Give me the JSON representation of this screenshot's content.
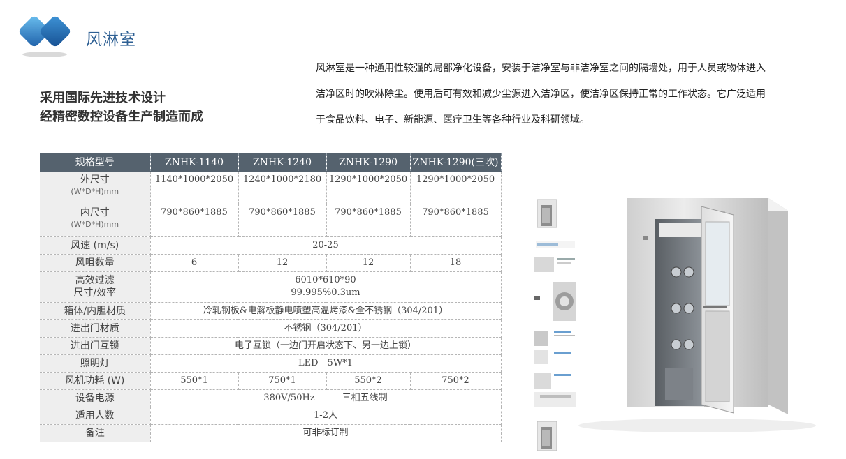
{
  "header": {
    "title": "风淋室",
    "slogan_lines": [
      "采用国际先进技术设计",
      "经精密数控设备生产制造而成"
    ]
  },
  "description": {
    "lines": [
      "风淋室是一种通用性较强的局部净化设备，安装于洁净室与非洁净室之间的隔墙处，用于人员或物体进入",
      "洁净区时的吹淋除尘。使用后可有效和减少尘源进入洁净区，使洁净区保持正常的工作状态。它广泛适用",
      "于食品饮料、电子、新能源、医疗卫生等各种行业及科研领域。"
    ]
  },
  "spec_table": {
    "header": [
      "规格型号",
      "ZNHK-1140",
      "ZNHK-1240",
      "ZNHK-1290",
      "ZNHK-1290(三吹)"
    ],
    "rows": [
      {
        "label": "外尺寸",
        "sub": "(W*D*H)mm",
        "cells": [
          "1140*1000*2050",
          "1240*1000*2180",
          "1290*1000*2050",
          "1290*1000*2050"
        ]
      },
      {
        "label": "内尺寸",
        "sub": "(W*D*H)mm",
        "cells": [
          "790*860*1885",
          "790*860*1885",
          "790*860*1885",
          "790*860*1885"
        ]
      },
      {
        "label": "风速 (m/s)",
        "span": "20-25"
      },
      {
        "label": "风咀数量",
        "cells": [
          "6",
          "12",
          "12",
          "18"
        ]
      },
      {
        "label": "高效过滤",
        "label2": "尺寸/效率",
        "span": "6010*610*90",
        "span2": "99.995%0.3um"
      },
      {
        "label": "箱体/内胆材质",
        "span": "冷轧钢板&电解板静电喷塑高温烤漆&全不锈钢（304/201）"
      },
      {
        "label": "进出门材质",
        "span": "不锈钢（304/201）"
      },
      {
        "label": "进出门互锁",
        "span": "电子互锁（一边门开启状态下、另一边上锁）"
      },
      {
        "label": "照明灯",
        "span": "LED　5W*1"
      },
      {
        "label": "风机功耗 (W)",
        "cells": [
          "550*1",
          "750*1",
          "550*2",
          "750*2"
        ]
      },
      {
        "label": "设备电源",
        "span": "380V/50Hz　　　三相五线制"
      },
      {
        "label": "适用人数",
        "span": "1-2人"
      },
      {
        "label": "备注",
        "span": "可非标订制"
      }
    ]
  },
  "colors": {
    "logo_blue": "#1f6fb8",
    "logo_light": "#5aa6e0",
    "table_header_bg": "#55626e",
    "label_bg": "#eeeeee"
  },
  "icons": {
    "logo": "overlapping-blue-diamonds-icon"
  }
}
